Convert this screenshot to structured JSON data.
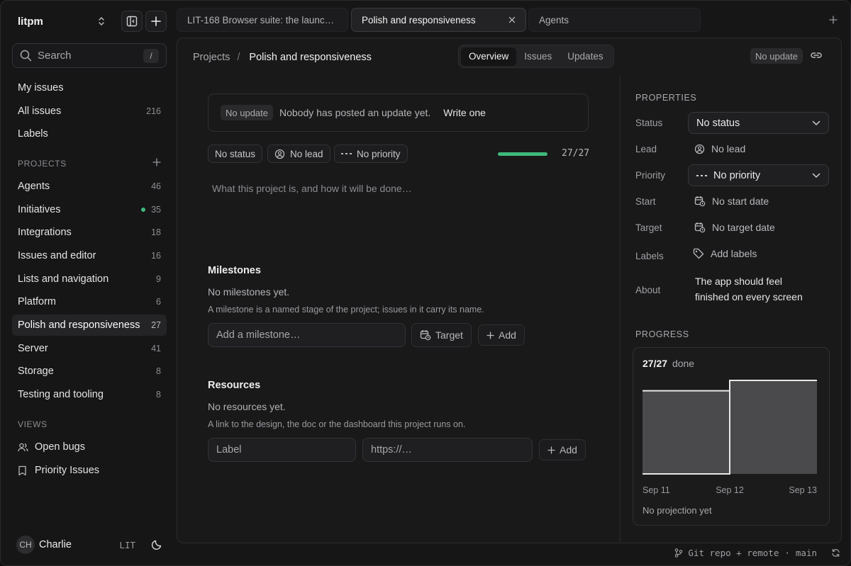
{
  "workspace": {
    "name": "litpm"
  },
  "search": {
    "placeholder": "Search",
    "shortcut": "/"
  },
  "nav": [
    {
      "label": "My issues",
      "count": ""
    },
    {
      "label": "All issues",
      "count": "216"
    },
    {
      "label": "Labels",
      "count": ""
    }
  ],
  "projects_label": "PROJECTS",
  "projects": [
    {
      "label": "Agents",
      "count": "46"
    },
    {
      "label": "Initiatives",
      "count": "35"
    },
    {
      "label": "Integrations",
      "count": "18"
    },
    {
      "label": "Issues and editor",
      "count": "16"
    },
    {
      "label": "Lists and navigation",
      "count": "9"
    },
    {
      "label": "Platform",
      "count": "6"
    },
    {
      "label": "Polish and responsiveness",
      "count": "27"
    },
    {
      "label": "Server",
      "count": "41"
    },
    {
      "label": "Storage",
      "count": "8"
    },
    {
      "label": "Testing and tooling",
      "count": "8"
    }
  ],
  "views_label": "VIEWS",
  "views": [
    {
      "label": "Open bugs",
      "icon": "users-icon"
    },
    {
      "label": "Priority Issues",
      "icon": "bookmark-icon"
    }
  ],
  "user": {
    "initials": "CH",
    "name": "Charlie",
    "team": "LIT"
  },
  "tabs": [
    {
      "label": "LIT-168 Browser suite: the launc…"
    },
    {
      "label": "Polish and responsiveness"
    },
    {
      "label": "Agents"
    }
  ],
  "breadcrumb": {
    "root": "Projects",
    "sep": "/",
    "current": "Polish and responsiveness"
  },
  "view_tabs": [
    "Overview",
    "Issues",
    "Updates"
  ],
  "header_badge": "No update",
  "update_banner": {
    "badge": "No update",
    "text": "Nobody has posted an update yet.",
    "action": "Write one"
  },
  "chips": {
    "status": "No status",
    "lead": "No lead",
    "priority": "No priority"
  },
  "progress": {
    "label": "27/27",
    "fraction": 1.0
  },
  "description_placeholder": "What this project is, and how it will be done…",
  "milestones": {
    "title": "Milestones",
    "empty": "No milestones yet.",
    "help": "A milestone is a named stage of the project; issues in it carry its name.",
    "input_placeholder": "Add a milestone…",
    "target_label": "Target",
    "add_label": "Add"
  },
  "resources": {
    "title": "Resources",
    "empty": "No resources yet.",
    "help": "A link to the design, the doc or the dashboard this project runs on.",
    "label_placeholder": "Label",
    "url_placeholder": "https://…",
    "add_label": "Add"
  },
  "properties": {
    "title": "PROPERTIES",
    "status": {
      "label": "Status",
      "value": "No status"
    },
    "lead": {
      "label": "Lead",
      "value": "No lead"
    },
    "priority": {
      "label": "Priority",
      "value": "No priority"
    },
    "start": {
      "label": "Start",
      "value": "No start date"
    },
    "target": {
      "label": "Target",
      "value": "No target date"
    },
    "labels": {
      "label": "Labels",
      "value": "Add labels"
    },
    "about": {
      "label": "About",
      "line1": "The app should feel",
      "line2": "finished on every screen"
    }
  },
  "progress_panel": {
    "title": "PROGRESS",
    "done_count": "27/27",
    "done_word": "done",
    "projection": "No projection yet"
  },
  "chart_data": {
    "type": "area",
    "x": [
      "Sep 11",
      "Sep 12",
      "Sep 13"
    ],
    "series": [
      {
        "values": [
          24,
          27,
          27
        ]
      }
    ],
    "ylim": [
      0,
      27
    ],
    "grid": false,
    "colors": {
      "fill": "#4a4a4c",
      "line": "#e8e8e8"
    }
  },
  "statusbar": {
    "repo": "Git repo + remote",
    "sep": "·",
    "branch": "main"
  },
  "colors": {
    "accent_green": "#3fb87a",
    "panel": "#19191a",
    "sidebar": "#161617"
  }
}
